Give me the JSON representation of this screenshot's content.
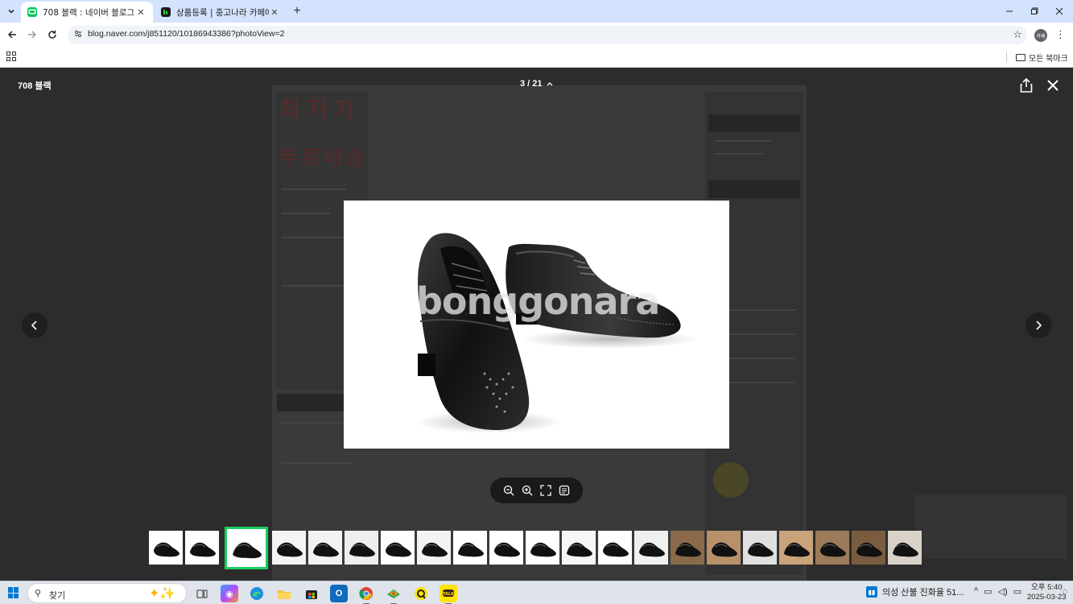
{
  "browser": {
    "tabs": [
      {
        "title": "708 블랙 : 네이버 블로그",
        "favicon": "naver-blog-icon",
        "active": true
      },
      {
        "title": "상품등록 | 중고나라 카페에서",
        "favicon": "joonggonara-icon",
        "active": false
      }
    ],
    "new_tab_label": "+",
    "url": "blog.naver.com/j851120/10186943386?photoView=2",
    "profile_initials": "카페",
    "bookmarks_folder_label": "모든 북마크"
  },
  "viewer": {
    "title": "708 블랙",
    "counter": "3 / 21",
    "watermark": "bonggonara",
    "current_index": 3,
    "total": 21,
    "background_text": {
      "promo_line1": "최저가",
      "promo_line2": "무료배송"
    },
    "thumbnail_count": 21,
    "selected_thumbnail": 3
  },
  "taskbar": {
    "search_placeholder": "찾기",
    "news_text": "의성 산불 진화율 51...",
    "clock_time": "오후 5:40",
    "clock_date": "2025-03-23"
  },
  "colors": {
    "accent_green": "#19ce60",
    "naver_green": "#03c75a",
    "tab_strip": "#d3e3fd",
    "viewer_bg": "#2c2c2c"
  }
}
